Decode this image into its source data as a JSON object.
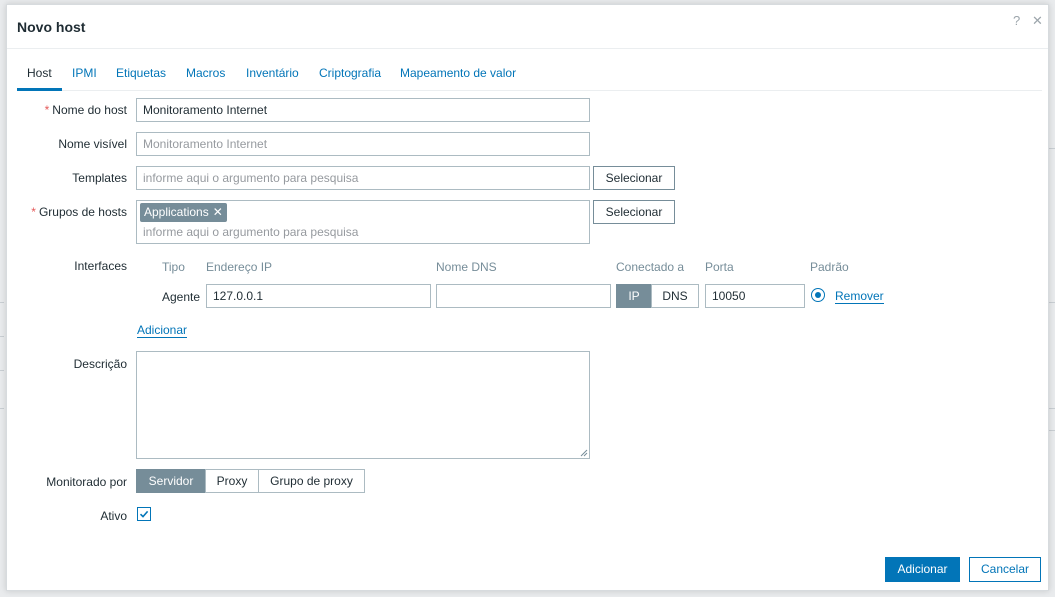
{
  "dialog": {
    "title": "Novo host",
    "help_icon": "?",
    "close_icon": "✕"
  },
  "tabs": [
    {
      "label": "Host",
      "active": true
    },
    {
      "label": "IPMI"
    },
    {
      "label": "Etiquetas"
    },
    {
      "label": "Macros"
    },
    {
      "label": "Inventário"
    },
    {
      "label": "Criptografia"
    },
    {
      "label": "Mapeamento de valor"
    }
  ],
  "form": {
    "host_name": {
      "label": "Nome do host",
      "required": "*",
      "value": "Monitoramento Internet"
    },
    "visible_name": {
      "label": "Nome visível",
      "placeholder": "Monitoramento Internet"
    },
    "templates": {
      "label": "Templates",
      "placeholder": "informe aqui o argumento para pesquisa",
      "button": "Selecionar"
    },
    "host_groups": {
      "label": "Grupos de hosts",
      "required": "*",
      "chips": [
        "Applications"
      ],
      "chip_remove": "✕",
      "placeholder": "informe aqui o argumento para pesquisa",
      "button": "Selecionar"
    },
    "interfaces": {
      "label": "Interfaces",
      "headers": {
        "type": "Tipo",
        "ip": "Endereço IP",
        "dns": "Nome DNS",
        "connect": "Conectado a",
        "port": "Porta",
        "default": "Padrão"
      },
      "rows": [
        {
          "type": "Agente",
          "ip": "127.0.0.1",
          "dns": "",
          "connect_options": [
            "IP",
            "DNS"
          ],
          "connect_selected": "IP",
          "port": "10050",
          "remove": "Remover"
        }
      ],
      "add_link": "Adicionar"
    },
    "description": {
      "label": "Descrição",
      "value": ""
    },
    "monitored_by": {
      "label": "Monitorado por",
      "options": [
        "Servidor",
        "Proxy",
        "Grupo de proxy"
      ],
      "selected": "Servidor"
    },
    "enabled": {
      "label": "Ativo",
      "checked": true
    }
  },
  "footer": {
    "add_button": "Adicionar",
    "cancel_button": "Cancelar"
  },
  "colors": {
    "accent": "#0275b8",
    "segment_active": "#768d99",
    "required": "#e45959"
  }
}
